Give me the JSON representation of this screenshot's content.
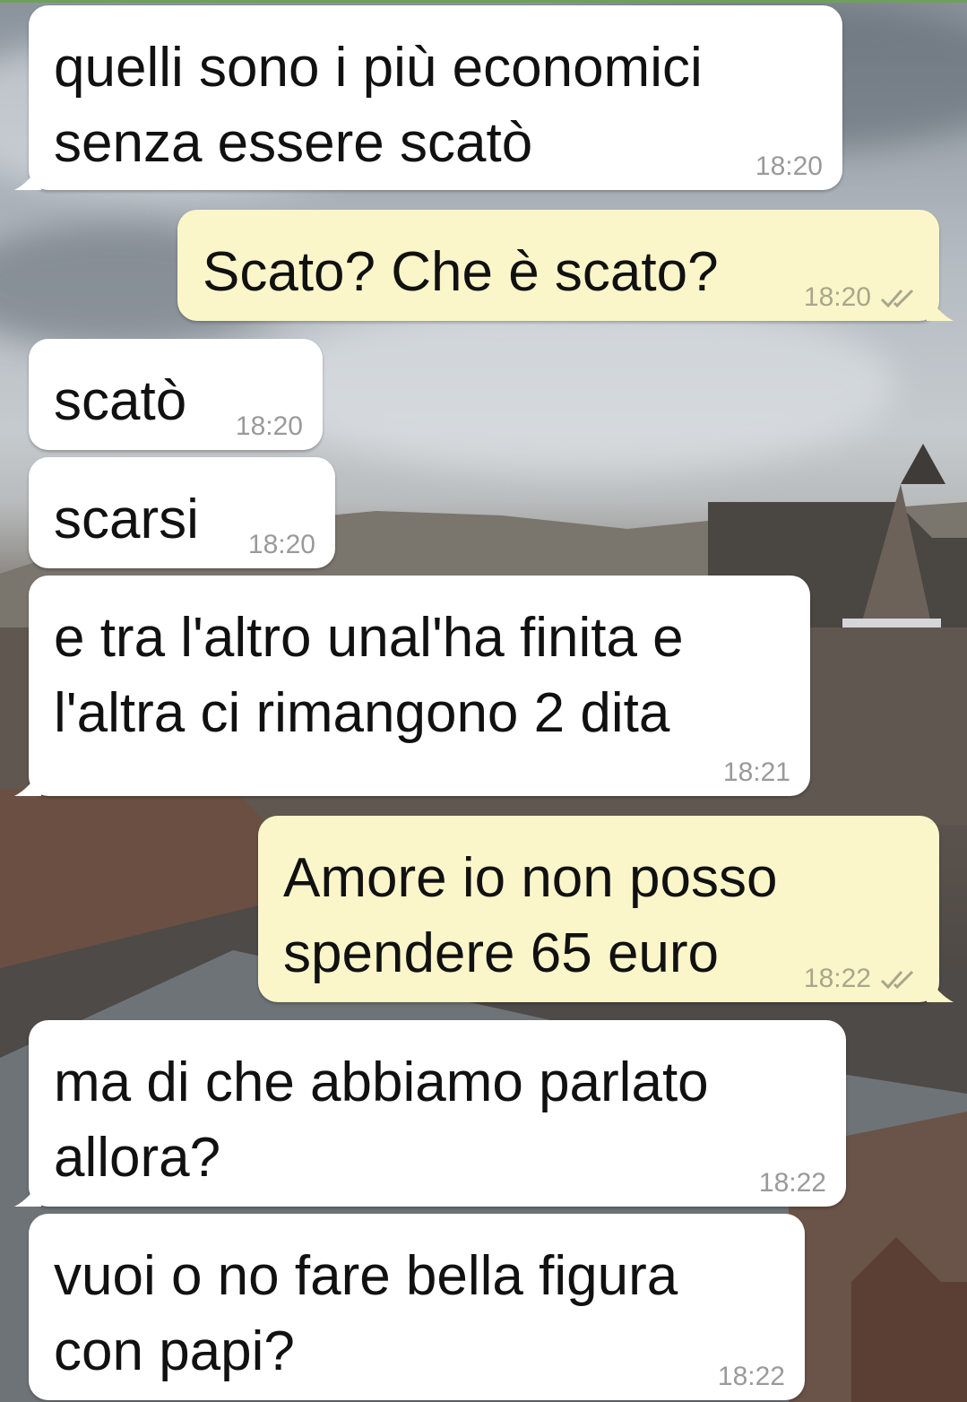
{
  "colors": {
    "incoming_bubble": "#ffffff",
    "outgoing_bubble": "#fbf6c9",
    "timestamp": "#9a9a9a",
    "read_ticks": "#a8a68c"
  },
  "messages": [
    {
      "direction": "incoming",
      "text": "quelli sono i più economici\nsenza essere scatò",
      "time": "18:20"
    },
    {
      "direction": "outgoing",
      "text": "Scato? Che è scato?",
      "time": "18:20",
      "status_icon": "double-check-icon"
    },
    {
      "direction": "incoming",
      "text": "scatò",
      "time": "18:20"
    },
    {
      "direction": "incoming",
      "text": "scarsi",
      "time": "18:20"
    },
    {
      "direction": "incoming",
      "text": "e tra l'altro unal'ha finita e\nl'altra ci rimangono 2 dita",
      "time": "18:21"
    },
    {
      "direction": "outgoing",
      "text": "Amore io non posso\nspendere 65 euro",
      "time": "18:22",
      "status_icon": "double-check-icon"
    },
    {
      "direction": "incoming",
      "text": "ma di che abbiamo parlato\nallora?",
      "time": "18:22"
    },
    {
      "direction": "incoming",
      "text": "vuoi o no fare bella figura\ncon papi?",
      "time": "18:22"
    }
  ]
}
